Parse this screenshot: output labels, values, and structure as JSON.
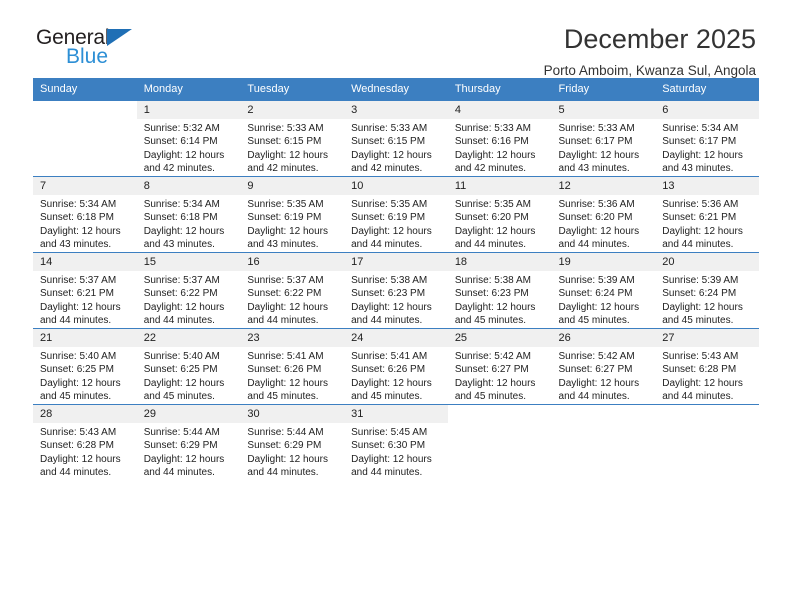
{
  "brand": {
    "name_part1": "General",
    "name_part2": "Blue",
    "triangle_color": "#1f6fb5",
    "blue_text_color": "#2d8fd5"
  },
  "header": {
    "title": "December 2025",
    "subtitle": "Porto Amboim, Kwanza Sul, Angola",
    "header_bg": "#3c7fc1"
  },
  "weekday_headers": [
    "Sunday",
    "Monday",
    "Tuesday",
    "Wednesday",
    "Thursday",
    "Friday",
    "Saturday"
  ],
  "weeks": [
    [
      {
        "day": "",
        "sunrise": "",
        "sunset": "",
        "daylight": ""
      },
      {
        "day": "1",
        "sunrise": "Sunrise: 5:32 AM",
        "sunset": "Sunset: 6:14 PM",
        "daylight": "Daylight: 12 hours and 42 minutes."
      },
      {
        "day": "2",
        "sunrise": "Sunrise: 5:33 AM",
        "sunset": "Sunset: 6:15 PM",
        "daylight": "Daylight: 12 hours and 42 minutes."
      },
      {
        "day": "3",
        "sunrise": "Sunrise: 5:33 AM",
        "sunset": "Sunset: 6:15 PM",
        "daylight": "Daylight: 12 hours and 42 minutes."
      },
      {
        "day": "4",
        "sunrise": "Sunrise: 5:33 AM",
        "sunset": "Sunset: 6:16 PM",
        "daylight": "Daylight: 12 hours and 42 minutes."
      },
      {
        "day": "5",
        "sunrise": "Sunrise: 5:33 AM",
        "sunset": "Sunset: 6:17 PM",
        "daylight": "Daylight: 12 hours and 43 minutes."
      },
      {
        "day": "6",
        "sunrise": "Sunrise: 5:34 AM",
        "sunset": "Sunset: 6:17 PM",
        "daylight": "Daylight: 12 hours and 43 minutes."
      }
    ],
    [
      {
        "day": "7",
        "sunrise": "Sunrise: 5:34 AM",
        "sunset": "Sunset: 6:18 PM",
        "daylight": "Daylight: 12 hours and 43 minutes."
      },
      {
        "day": "8",
        "sunrise": "Sunrise: 5:34 AM",
        "sunset": "Sunset: 6:18 PM",
        "daylight": "Daylight: 12 hours and 43 minutes."
      },
      {
        "day": "9",
        "sunrise": "Sunrise: 5:35 AM",
        "sunset": "Sunset: 6:19 PM",
        "daylight": "Daylight: 12 hours and 43 minutes."
      },
      {
        "day": "10",
        "sunrise": "Sunrise: 5:35 AM",
        "sunset": "Sunset: 6:19 PM",
        "daylight": "Daylight: 12 hours and 44 minutes."
      },
      {
        "day": "11",
        "sunrise": "Sunrise: 5:35 AM",
        "sunset": "Sunset: 6:20 PM",
        "daylight": "Daylight: 12 hours and 44 minutes."
      },
      {
        "day": "12",
        "sunrise": "Sunrise: 5:36 AM",
        "sunset": "Sunset: 6:20 PM",
        "daylight": "Daylight: 12 hours and 44 minutes."
      },
      {
        "day": "13",
        "sunrise": "Sunrise: 5:36 AM",
        "sunset": "Sunset: 6:21 PM",
        "daylight": "Daylight: 12 hours and 44 minutes."
      }
    ],
    [
      {
        "day": "14",
        "sunrise": "Sunrise: 5:37 AM",
        "sunset": "Sunset: 6:21 PM",
        "daylight": "Daylight: 12 hours and 44 minutes."
      },
      {
        "day": "15",
        "sunrise": "Sunrise: 5:37 AM",
        "sunset": "Sunset: 6:22 PM",
        "daylight": "Daylight: 12 hours and 44 minutes."
      },
      {
        "day": "16",
        "sunrise": "Sunrise: 5:37 AM",
        "sunset": "Sunset: 6:22 PM",
        "daylight": "Daylight: 12 hours and 44 minutes."
      },
      {
        "day": "17",
        "sunrise": "Sunrise: 5:38 AM",
        "sunset": "Sunset: 6:23 PM",
        "daylight": "Daylight: 12 hours and 44 minutes."
      },
      {
        "day": "18",
        "sunrise": "Sunrise: 5:38 AM",
        "sunset": "Sunset: 6:23 PM",
        "daylight": "Daylight: 12 hours and 45 minutes."
      },
      {
        "day": "19",
        "sunrise": "Sunrise: 5:39 AM",
        "sunset": "Sunset: 6:24 PM",
        "daylight": "Daylight: 12 hours and 45 minutes."
      },
      {
        "day": "20",
        "sunrise": "Sunrise: 5:39 AM",
        "sunset": "Sunset: 6:24 PM",
        "daylight": "Daylight: 12 hours and 45 minutes."
      }
    ],
    [
      {
        "day": "21",
        "sunrise": "Sunrise: 5:40 AM",
        "sunset": "Sunset: 6:25 PM",
        "daylight": "Daylight: 12 hours and 45 minutes."
      },
      {
        "day": "22",
        "sunrise": "Sunrise: 5:40 AM",
        "sunset": "Sunset: 6:25 PM",
        "daylight": "Daylight: 12 hours and 45 minutes."
      },
      {
        "day": "23",
        "sunrise": "Sunrise: 5:41 AM",
        "sunset": "Sunset: 6:26 PM",
        "daylight": "Daylight: 12 hours and 45 minutes."
      },
      {
        "day": "24",
        "sunrise": "Sunrise: 5:41 AM",
        "sunset": "Sunset: 6:26 PM",
        "daylight": "Daylight: 12 hours and 45 minutes."
      },
      {
        "day": "25",
        "sunrise": "Sunrise: 5:42 AM",
        "sunset": "Sunset: 6:27 PM",
        "daylight": "Daylight: 12 hours and 45 minutes."
      },
      {
        "day": "26",
        "sunrise": "Sunrise: 5:42 AM",
        "sunset": "Sunset: 6:27 PM",
        "daylight": "Daylight: 12 hours and 44 minutes."
      },
      {
        "day": "27",
        "sunrise": "Sunrise: 5:43 AM",
        "sunset": "Sunset: 6:28 PM",
        "daylight": "Daylight: 12 hours and 44 minutes."
      }
    ],
    [
      {
        "day": "28",
        "sunrise": "Sunrise: 5:43 AM",
        "sunset": "Sunset: 6:28 PM",
        "daylight": "Daylight: 12 hours and 44 minutes."
      },
      {
        "day": "29",
        "sunrise": "Sunrise: 5:44 AM",
        "sunset": "Sunset: 6:29 PM",
        "daylight": "Daylight: 12 hours and 44 minutes."
      },
      {
        "day": "30",
        "sunrise": "Sunrise: 5:44 AM",
        "sunset": "Sunset: 6:29 PM",
        "daylight": "Daylight: 12 hours and 44 minutes."
      },
      {
        "day": "31",
        "sunrise": "Sunrise: 5:45 AM",
        "sunset": "Sunset: 6:30 PM",
        "daylight": "Daylight: 12 hours and 44 minutes."
      },
      {
        "day": "",
        "sunrise": "",
        "sunset": "",
        "daylight": ""
      },
      {
        "day": "",
        "sunrise": "",
        "sunset": "",
        "daylight": ""
      },
      {
        "day": "",
        "sunrise": "",
        "sunset": "",
        "daylight": ""
      }
    ]
  ]
}
